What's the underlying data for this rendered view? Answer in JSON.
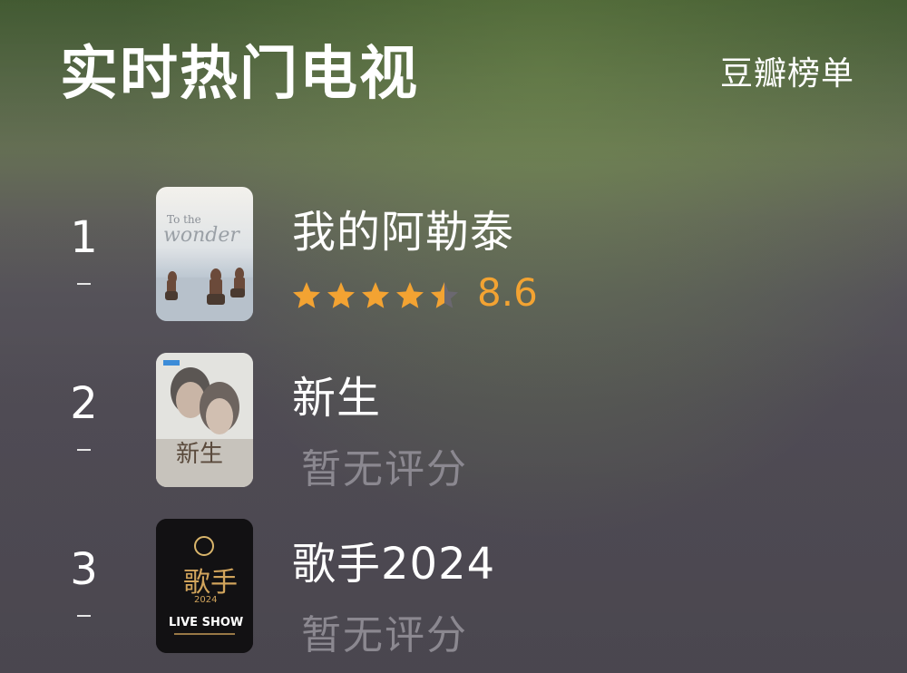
{
  "header": {
    "title": "实时热门电视",
    "source": "豆瓣榜单"
  },
  "shows": [
    {
      "rank": "1",
      "name": "我的阿勒泰",
      "rating": 8.6,
      "rating_text": "8.6",
      "stars": 4.5,
      "poster": {
        "caption": "To the wonder",
        "icon": "grassland-riders-poster"
      }
    },
    {
      "rank": "2",
      "name": "新生",
      "rating_text": "暂无评分",
      "poster": {
        "icon": "two-faces-poster"
      }
    },
    {
      "rank": "3",
      "name": "歌手2024",
      "rating_text": "暂无评分",
      "poster": {
        "icon": "singer-live-show-poster"
      }
    }
  ],
  "colors": {
    "accent": "#f3a332",
    "muted": "#8b8890"
  }
}
